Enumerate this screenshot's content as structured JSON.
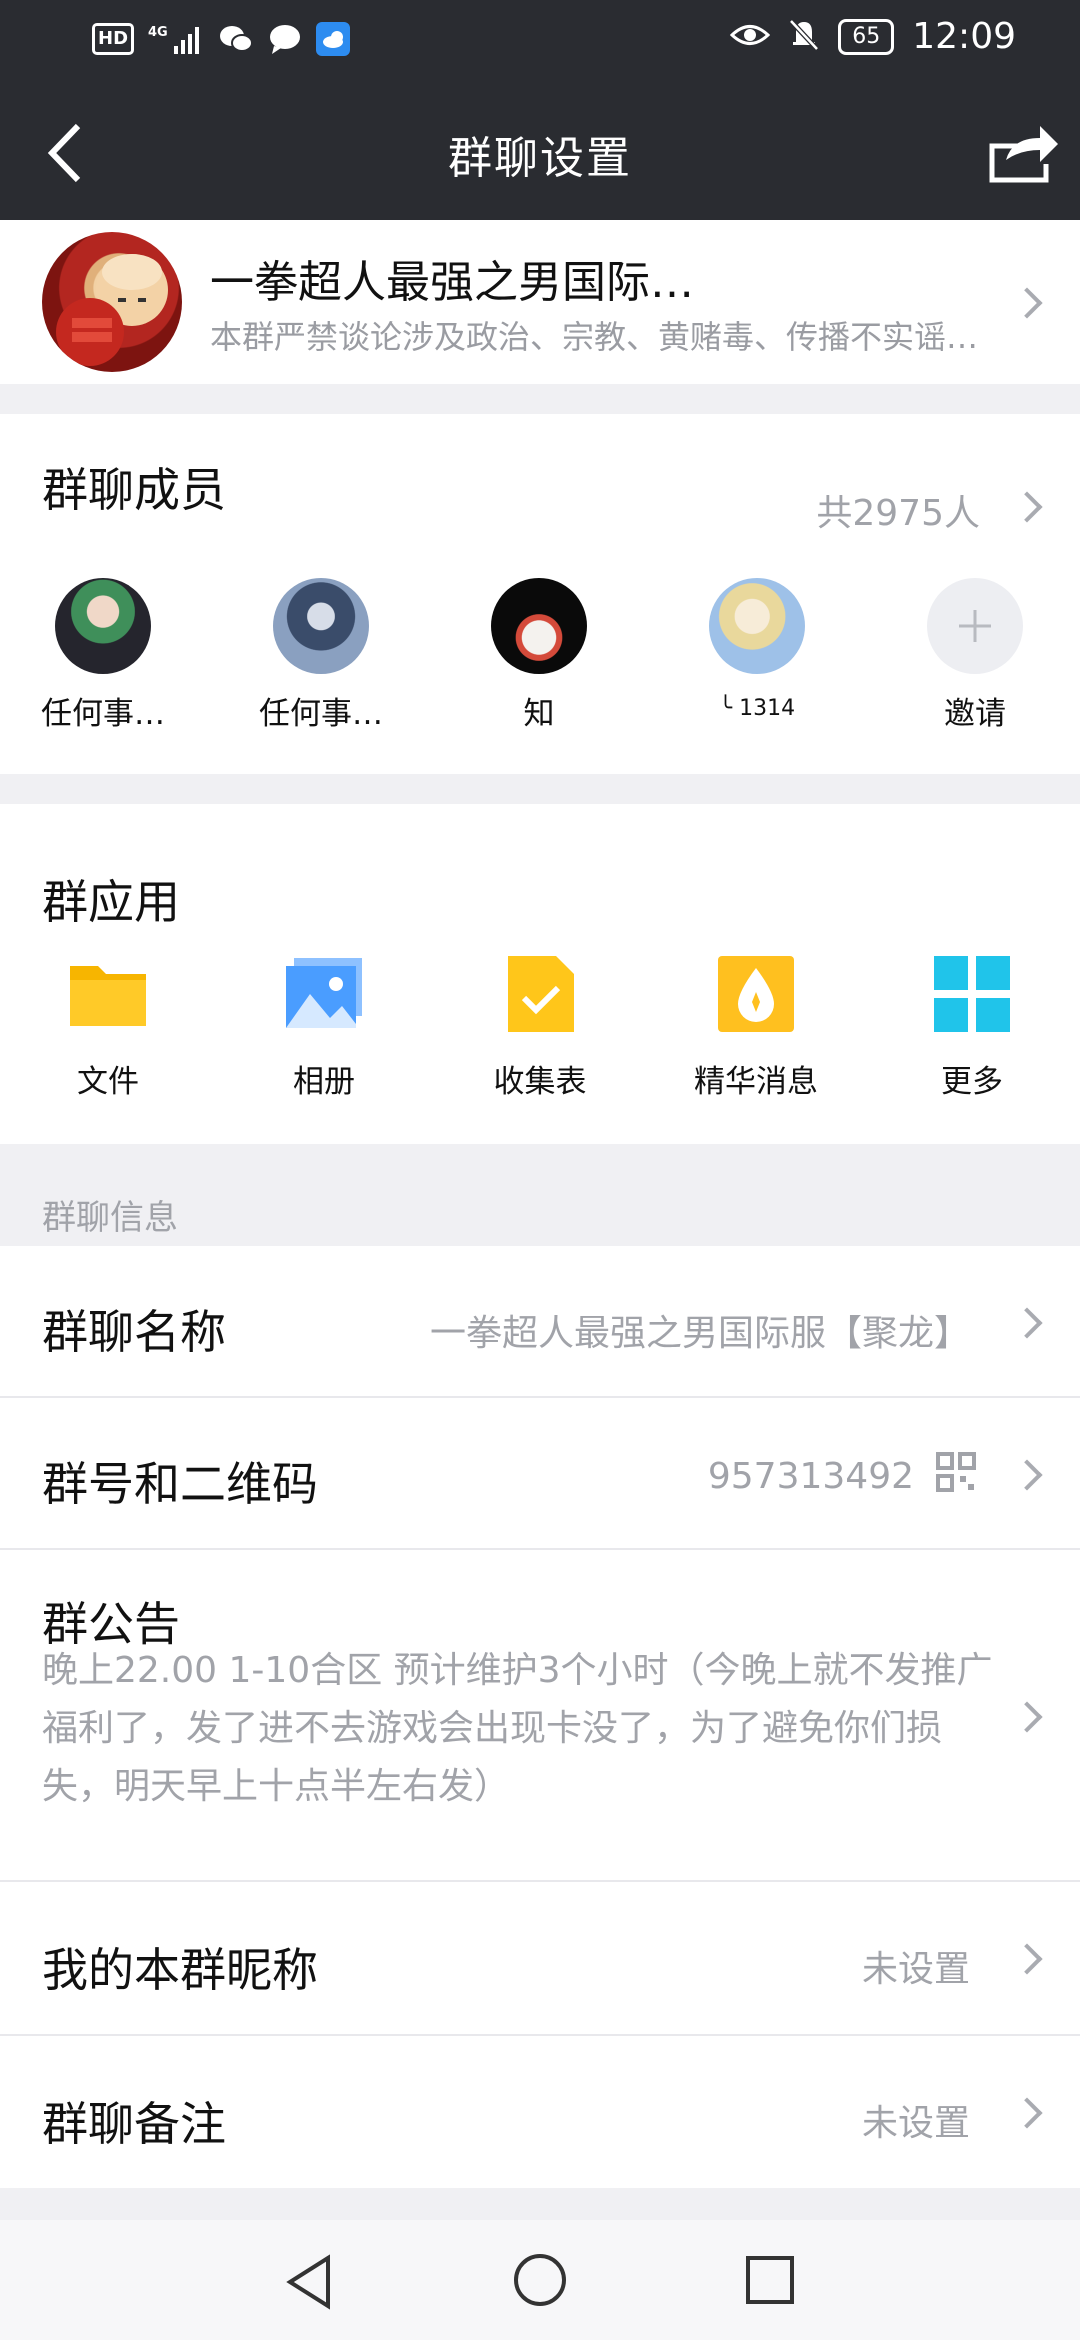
{
  "status_bar": {
    "hd": "HD",
    "network": "4G",
    "battery": "65",
    "time": "12:09"
  },
  "header": {
    "title": "群聊设置"
  },
  "group": {
    "name": "一拳超人最强之男国际…",
    "description": "本群严禁谈论涉及政治、宗教、黄赌毒、传播不实谣…"
  },
  "members": {
    "title": "群聊成员",
    "count": "共2975人",
    "items": [
      {
        "name": "任何事…"
      },
      {
        "name": "任何事…"
      },
      {
        "name": "知"
      },
      {
        "name": "╰ 1314"
      },
      {
        "name": "邀请"
      }
    ]
  },
  "apps": {
    "title": "群应用",
    "items": [
      {
        "label": "文件",
        "icon": "folder-icon"
      },
      {
        "label": "相册",
        "icon": "album-icon"
      },
      {
        "label": "收集表",
        "icon": "form-icon"
      },
      {
        "label": "精华消息",
        "icon": "essence-icon"
      },
      {
        "label": "更多",
        "icon": "grid-more-icon"
      }
    ]
  },
  "info": {
    "header": "群聊信息",
    "name_label": "群聊名称",
    "name_value": "一拳超人最强之男国际服【聚龙】",
    "id_label": "群号和二维码",
    "id_value": "957313492",
    "notice_label": "群公告",
    "notice_text": "晚上22.00 1-10合区 预计维护3个小时（今晚上就不发推广福利了，发了进不去游戏会出现卡没了，为了避免你们损失，明天早上十点半左右发）",
    "nickname_label": "我的本群昵称",
    "nickname_value": "未设置",
    "remark_label": "群聊备注",
    "remark_value": "未设置"
  },
  "colors": {
    "header_bg": "#2a2c31",
    "page_bg": "#f0f0f3",
    "secondary_text": "#a1a3a9"
  }
}
